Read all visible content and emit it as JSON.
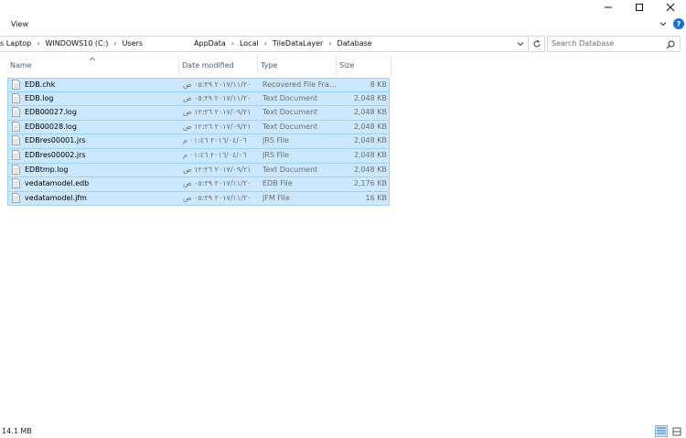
{
  "ribbon": {
    "view_tab": "View"
  },
  "address": {
    "crumbs": [
      "s Laptop",
      "WINDOWS10 (C:)",
      "Users",
      "AppData",
      "Local",
      "TileDataLayer",
      "Database"
    ]
  },
  "search": {
    "placeholder": "Search Database"
  },
  "columns": {
    "name": "Name",
    "date": "Date modified",
    "type": "Type",
    "size": "Size"
  },
  "files": [
    {
      "name": "EDB.chk",
      "date": "٢٠١٧/١١/٢٠ ٠٥:٢٩ ص",
      "type": "Recovered File Fra...",
      "size": "8 KB"
    },
    {
      "name": "EDB.log",
      "date": "٢٠١٧/١١/٢٠ ٠٥:٢٩ ص",
      "type": "Text Document",
      "size": "2,048 KB"
    },
    {
      "name": "EDB00027.log",
      "date": "٢٠١٧/٠٩/٢١ ١٢:٢٦ ص",
      "type": "Text Document",
      "size": "2,048 KB"
    },
    {
      "name": "EDB00028.log",
      "date": "٢٠١٧/٠٩/٢١ ١٢:٢٦ ص",
      "type": "Text Document",
      "size": "2,048 KB"
    },
    {
      "name": "EDBres00001.jrs",
      "date": "٢٠١٦/٠٤/٠٦ ٠١:٤٦ م",
      "type": "JRS File",
      "size": "2,048 KB"
    },
    {
      "name": "EDBres00002.jrs",
      "date": "٢٠١٦/٠٤/٠٦ ٠١:٤٦ م",
      "type": "JRS File",
      "size": "2,048 KB"
    },
    {
      "name": "EDBtmp.log",
      "date": "٢٠١٧/٠٩/٢١ ١٢:٢٦ ص",
      "type": "Text Document",
      "size": "2,048 KB"
    },
    {
      "name": "vedatamodel.edb",
      "date": "٢٠١٧/١١/٢٠ ٠٥:٢٩ ص",
      "type": "EDB File",
      "size": "2,176 KB"
    },
    {
      "name": "vedatamodel.jfm",
      "date": "٢٠١٧/١١/٢٠ ٠٥:٢٩ ص",
      "type": "JFM File",
      "size": "16 KB"
    }
  ],
  "status": {
    "size_text": "14.1 MB"
  },
  "icons": {
    "minimize": "minimize-icon",
    "maximize": "maximize-icon",
    "close": "close-icon",
    "help": "help-icon",
    "refresh": "refresh-icon",
    "search": "search-icon",
    "file": "document-icon"
  },
  "colors": {
    "selection": "#cce8ff",
    "selection_border": "#99d1ff",
    "header_text": "#4c607a",
    "help": "#1a6fd6"
  }
}
